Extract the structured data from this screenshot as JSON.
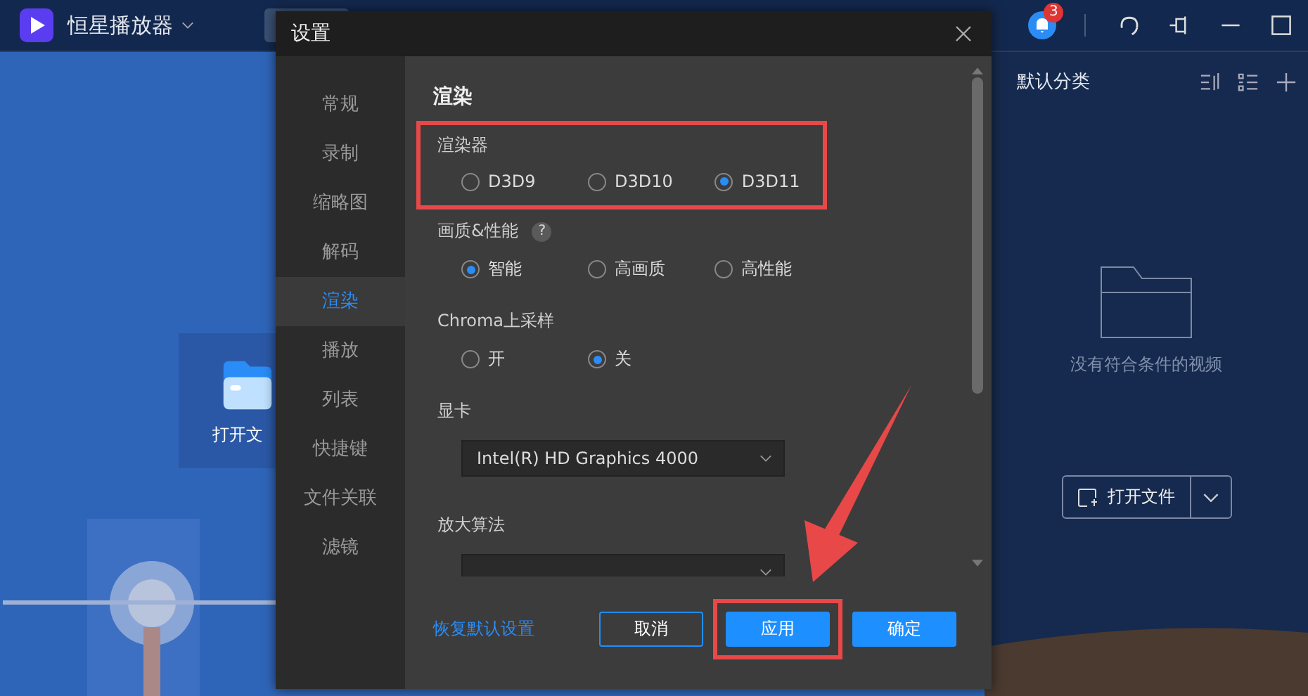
{
  "app": {
    "title": "恒星播放器",
    "notifications": "3"
  },
  "main": {
    "open_tile": "打开文"
  },
  "playlist": {
    "title": "默认分类",
    "empty_text": "没有符合条件的视频",
    "open_button": "打开文件"
  },
  "dialog": {
    "title": "设置",
    "nav": [
      {
        "label": "常规",
        "selected": false
      },
      {
        "label": "录制",
        "selected": false
      },
      {
        "label": "缩略图",
        "selected": false
      },
      {
        "label": "解码",
        "selected": false
      },
      {
        "label": "渲染",
        "selected": true
      },
      {
        "label": "播放",
        "selected": false
      },
      {
        "label": "列表",
        "selected": false
      },
      {
        "label": "快捷键",
        "selected": false
      },
      {
        "label": "文件关联",
        "selected": false
      },
      {
        "label": "滤镜",
        "selected": false
      }
    ],
    "heading": "渲染",
    "settings": [
      {
        "kind": "radio",
        "label": "渲染器",
        "highlighted": true,
        "options": [
          {
            "label": "D3D9",
            "selected": false
          },
          {
            "label": "D3D10",
            "selected": false
          },
          {
            "label": "D3D11",
            "selected": true
          }
        ]
      },
      {
        "kind": "radio",
        "label": "画质&性能",
        "help": "?",
        "highlighted": false,
        "options": [
          {
            "label": "智能",
            "selected": true
          },
          {
            "label": "高画质",
            "selected": false
          },
          {
            "label": "高性能",
            "selected": false
          }
        ]
      },
      {
        "kind": "radio",
        "label": "Chroma上采样",
        "highlighted": false,
        "options": [
          {
            "label": "开",
            "selected": false
          },
          {
            "label": "关",
            "selected": true
          }
        ]
      },
      {
        "kind": "select",
        "label": "显卡",
        "value": "Intel(R) HD Graphics 4000",
        "highlighted": false
      },
      {
        "kind": "select",
        "label": "放大算法",
        "highlighted": false
      }
    ],
    "reset_link": "恢复默认设置",
    "buttons": [
      {
        "label": "取消",
        "kind": "secondary",
        "highlighted": false
      },
      {
        "label": "应用",
        "kind": "primary",
        "highlighted": true
      },
      {
        "label": "确定",
        "kind": "primary",
        "highlighted": false
      }
    ]
  },
  "annotations": [
    {
      "kind": "arrow"
    }
  ]
}
